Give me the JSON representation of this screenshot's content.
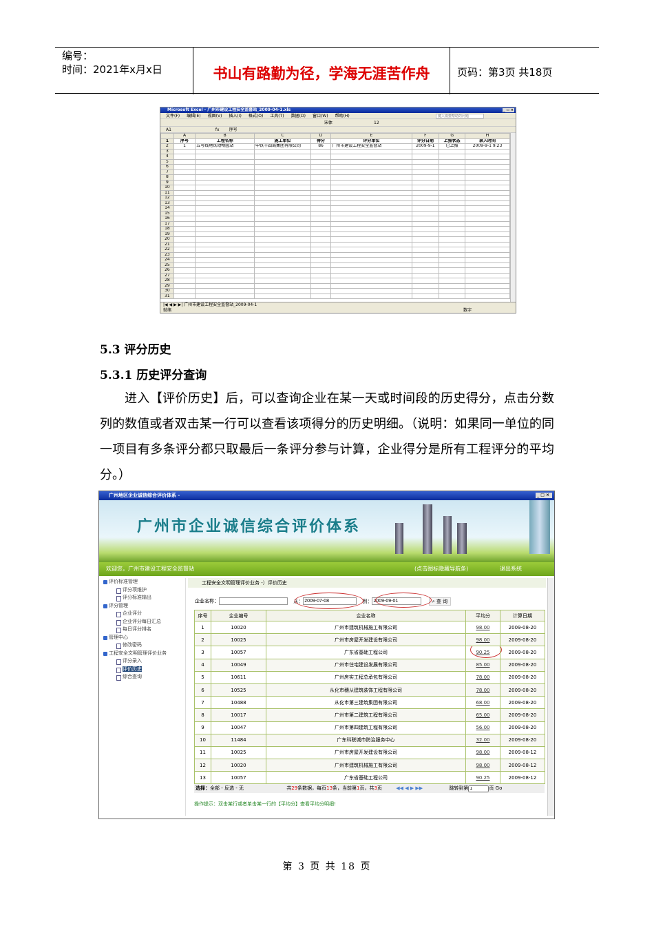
{
  "header": {
    "number_label": "编号：",
    "time_label": "时间：2021年x月x日",
    "motto": "书山有路勤为径，学海无涯苦作舟",
    "page_label": "页码：第3页  共18页"
  },
  "excel": {
    "title": "Microsoft Excel - 广州市建设工程安全监督站_2009-04-1.xls",
    "window_buttons": "_ ▭ ×",
    "menu": [
      "文件(F)",
      "编辑(E)",
      "视图(V)",
      "插入(I)",
      "格式(O)",
      "工具(T)",
      "数据(D)",
      "窗口(W)",
      "帮助(H)"
    ],
    "help_placeholder": "键入需要帮助的问题",
    "font_name": "宋体",
    "font_size": "12",
    "cell_ref": "A1",
    "formula": "序号",
    "col_letters": [
      "A",
      "B",
      "C",
      "D",
      "E",
      "F",
      "G",
      "H"
    ],
    "headers": [
      "序号",
      "工程名称",
      "施工单位",
      "得分",
      "评分单位",
      "评分日期",
      "上报状态",
      "录入时间"
    ],
    "row": [
      "1",
      "五号线地铁动物园站",
      "中铁十四局集团有限公司",
      "86",
      "广州市建设工程安全监督站",
      "2009-9-1",
      "已上报",
      "2009-9-1 9:23"
    ],
    "row_count": 31,
    "sheet_tab": "广州市建设工程安全监督站_2009-04-1",
    "status_left": "就绪",
    "status_right": "数字"
  },
  "section": {
    "h1": "5.3 评分历史",
    "h2": "5.3.1 历史评分查询",
    "paragraph": "进入【评价历史】后，可以查询企业在某一天或时间段的历史得分，点击分数列的数值或者双击某一行可以查看该项得分的历史明细。（说明：如果同一单位的同一项目有多条评分都只取最后一条评分参与计算，企业得分是所有工程评分的平均分。）"
  },
  "app": {
    "window_title": "广州地区企业诚信综合评价体系 -",
    "banner_title": "广州市企业诚信综合评价体系",
    "welcome": "欢迎您，广州市建设工程安全监督站",
    "hide_nav": "(点击图标隐藏导航条)",
    "logout": "退出系统",
    "sidebar": [
      {
        "type": "g",
        "label": "评价标准管理"
      },
      {
        "type": "i",
        "label": "评分项维护"
      },
      {
        "type": "i",
        "label": "评分标准输出"
      },
      {
        "type": "g",
        "label": "评分管理"
      },
      {
        "type": "i",
        "label": "企业评分"
      },
      {
        "type": "i",
        "label": "企业评分每日汇总"
      },
      {
        "type": "i",
        "label": "每日评分排名"
      },
      {
        "type": "g",
        "label": "管理中心"
      },
      {
        "type": "i",
        "label": "修改密码"
      },
      {
        "type": "g",
        "label": "工程安全文明管理评价业务"
      },
      {
        "type": "i",
        "label": "评分录入"
      },
      {
        "type": "i",
        "label": "评价历史",
        "selected": true
      },
      {
        "type": "i",
        "label": "综合查询"
      }
    ],
    "breadcrumb": "工程安全文明管理评价业务 -）评价历史",
    "company_label": "企业名称：",
    "company_value": "",
    "from_label": "从：",
    "from_value": "2009-07-08",
    "to_label": "到：",
    "to_value": "2009-09-01",
    "query_button": "查 询",
    "columns": [
      "序号",
      "企业编号",
      "企业名称",
      "平均分",
      "计算日期"
    ],
    "rows": [
      [
        "1",
        "10020",
        "广州市建筑机械施工有限公司",
        "98.00",
        "2009-08-20"
      ],
      [
        "2",
        "10025",
        "广州市房屋开发建设有限公司",
        "98.00",
        "2009-08-20"
      ],
      [
        "3",
        "10057",
        "广东省基础工程公司",
        "90.25",
        "2009-08-20"
      ],
      [
        "4",
        "10049",
        "广州市住宅建设发展有限公司",
        "85.00",
        "2009-08-20"
      ],
      [
        "5",
        "10611",
        "广州房实工程总承包有限公司",
        "78.00",
        "2009-08-20"
      ],
      [
        "6",
        "10525",
        "从化市穗从建筑装饰工程有限公司",
        "78.00",
        "2009-08-20"
      ],
      [
        "7",
        "10488",
        "从化市第三建筑集团有限公司",
        "68.00",
        "2009-08-20"
      ],
      [
        "8",
        "10017",
        "广州市第二建筑工程有限公司",
        "65.00",
        "2009-08-20"
      ],
      [
        "9",
        "10047",
        "广州市第四建筑工程有限公司",
        "56.00",
        "2009-08-20"
      ],
      [
        "10",
        "11484",
        "广东科联城市防治服务中心",
        "32.00",
        "2009-08-20"
      ],
      [
        "11",
        "10025",
        "广州市房屋开发建设有限公司",
        "98.00",
        "2009-08-12"
      ],
      [
        "12",
        "10020",
        "广州市建筑机械施工有限公司",
        "98.00",
        "2009-08-12"
      ],
      [
        "13",
        "10057",
        "广东省基础工程公司",
        "90.25",
        "2009-08-12"
      ]
    ],
    "pager": {
      "select_label": "选择：",
      "select_opts": "全部 - 反选 - 无",
      "total_pre": "共",
      "total": "29",
      "total_suf": "条数据，每页",
      "per": "13",
      "per_suf": "条，当前第",
      "cur": "1",
      "cur_suf": "页，共",
      "pages": "3",
      "pages_suf": "页",
      "nav": "◀◀ ◀ ▶ ▶▶",
      "jump_label": "跳转到第",
      "jump_value": "1",
      "jump_suf": "页",
      "go": "Go"
    },
    "tip": "操作提示：双击某行或者单击某一行的【平均分】查看平均分明细!"
  },
  "footer": "第 3 页 共 18 页"
}
